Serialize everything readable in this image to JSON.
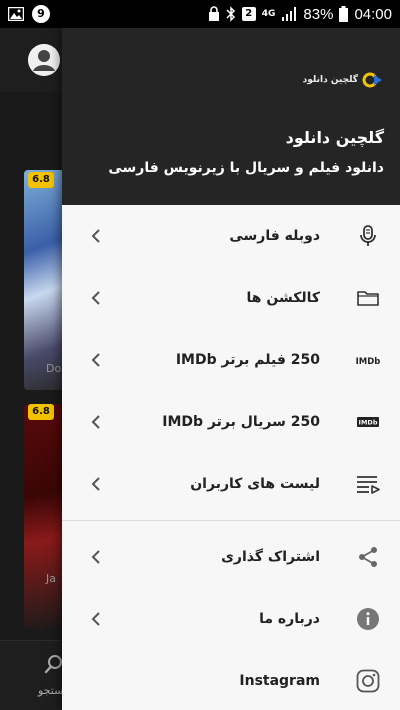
{
  "status_bar": {
    "notification_count": "9",
    "sim_slot": "2",
    "network": "4G",
    "battery": "83%",
    "time": "04:00"
  },
  "background": {
    "cards": [
      {
        "rating": "6.8",
        "title_fragment": "Do"
      },
      {
        "rating": "6.8",
        "title_fragment": "Ja"
      }
    ],
    "bottom_nav": {
      "search_label_fragment": "ستجو"
    }
  },
  "drawer": {
    "logo_text": "گلچین دانلود",
    "header_title": "گلچین دانلود",
    "header_subtitle": "دانلود فیلم و سریال با زیرنویس فارسی",
    "menu_group_1": [
      {
        "label": "دوبله فارسی",
        "icon": "microphone-icon"
      },
      {
        "label": "کالکشن ها",
        "icon": "folder-icon"
      },
      {
        "label": "250 فیلم برتر IMDb",
        "icon": "imdb-icon",
        "icon_text": "IMDb"
      },
      {
        "label": "250 سریال برتر IMDb",
        "icon": "imdb-badge-icon",
        "icon_text": "IMDb"
      },
      {
        "label": "لیست های کاربران",
        "icon": "playlist-icon"
      }
    ],
    "menu_group_2": [
      {
        "label": "اشتراک گذاری",
        "icon": "share-icon"
      },
      {
        "label": "درباره ما",
        "icon": "info-icon"
      },
      {
        "label": "Instagram",
        "icon": "instagram-icon"
      }
    ]
  },
  "colors": {
    "drawer_header_bg": "#252525",
    "drawer_bg": "#f7f7f7",
    "rating_badge": "#f2c200",
    "logo_accent": "#f2c200",
    "logo_blue": "#2a6fd6"
  }
}
